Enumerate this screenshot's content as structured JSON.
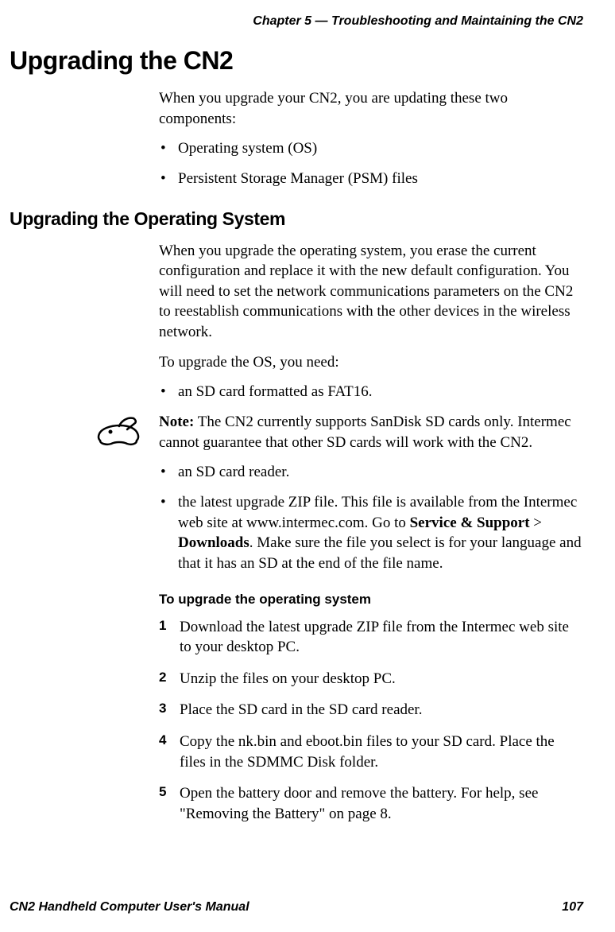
{
  "header": "Chapter 5 — Troubleshooting and Maintaining the CN2",
  "h1": "Upgrading the CN2",
  "intro": "When you upgrade your CN2, you are updating these two components:",
  "intro_bullets": [
    "Operating system (OS)",
    "Persistent Storage Manager (PSM) files"
  ],
  "h2": "Upgrading the Operating System",
  "os_para": "When you upgrade the operating system, you erase the current configuration and replace it with the new default configuration. You will need to set the network communications parameters on the CN2 to reestablish communications with the other devices in the wireless network.",
  "os_need": "To upgrade the OS, you need:",
  "need_bullet1": "an SD card formatted as FAT16.",
  "note": {
    "label": "Note:",
    "text": " The CN2 currently supports SanDisk SD cards only. Intermec cannot guarantee that other SD cards will work with the CN2."
  },
  "need_bullet2": "an SD card reader.",
  "need_bullet3_pre": "the latest upgrade ZIP file. This file is available from the Intermec web site at www.intermec.com. Go to ",
  "need_bullet3_b1": "Service & Support",
  "need_bullet3_gt": " > ",
  "need_bullet3_b2": "Downloads",
  "need_bullet3_post": ". Make sure the file you select is for your language and that it has an SD at the end of the file name.",
  "h3": "To upgrade the operating system",
  "steps": [
    "Download the latest upgrade ZIP file from the Intermec web site to your desktop PC.",
    "Unzip the files on your desktop PC.",
    "Place the SD card in the SD card reader.",
    "Copy the nk.bin and eboot.bin files to your SD card. Place the files in the SDMMC Disk folder.",
    "Open the battery door and remove the battery. For help, see \"Removing the Battery\" on page 8."
  ],
  "footer_left": "CN2 Handheld Computer User's Manual",
  "footer_right": "107"
}
